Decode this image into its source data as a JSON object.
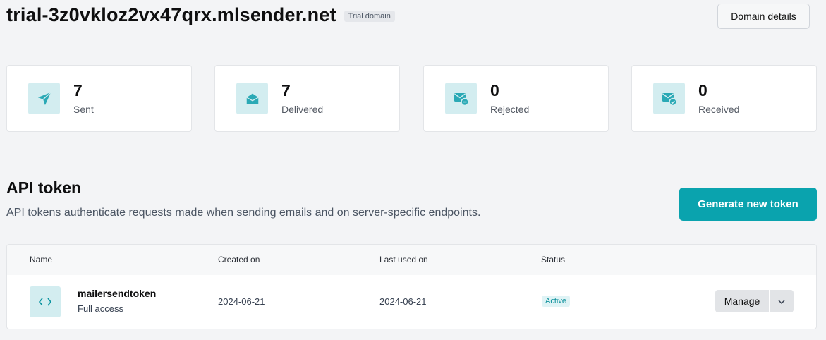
{
  "header": {
    "domain": "trial-3z0vkloz2vx47qrx.mlsender.net",
    "badge": "Trial domain",
    "details_button": "Domain details"
  },
  "stats": [
    {
      "value": "7",
      "label": "Sent",
      "icon": "paper-plane-icon"
    },
    {
      "value": "7",
      "label": "Delivered",
      "icon": "open-envelope-icon"
    },
    {
      "value": "0",
      "label": "Rejected",
      "icon": "mail-rejected-icon"
    },
    {
      "value": "0",
      "label": "Received",
      "icon": "mail-received-icon"
    }
  ],
  "api": {
    "title": "API token",
    "description": "API tokens authenticate requests made when sending emails and on server-specific endpoints.",
    "generate_button": "Generate new token",
    "columns": [
      "Name",
      "Created on",
      "Last used on",
      "Status"
    ],
    "tokens": [
      {
        "name": "mailersendtoken",
        "access": "Full access",
        "created": "2024-06-21",
        "last_used": "2024-06-21",
        "status": "Active",
        "manage": "Manage"
      }
    ]
  },
  "colors": {
    "accent": "#0aa3ae",
    "icon_bg": "#d3edf0",
    "page_bg": "#f3f4f6"
  }
}
